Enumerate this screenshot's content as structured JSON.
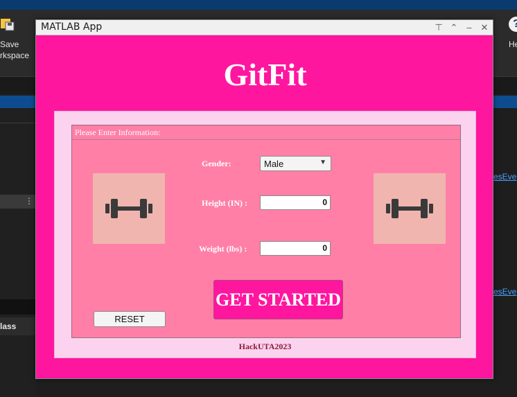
{
  "background": {
    "save_label_line1": "Save",
    "save_label_line2": "rkspace",
    "help_label": "He",
    "left_pane_class_label": "lass",
    "link_fragment": "esEve"
  },
  "window": {
    "title": "MATLAB App",
    "controls": {
      "pin": "⊤",
      "collapse": "⌃",
      "minimize": "–",
      "close": "✕"
    }
  },
  "app": {
    "title": "GitFit",
    "panel_title": "Please Enter Information:",
    "fields": {
      "gender_label": "Gender:",
      "gender_value": "Male",
      "height_label": "Height (IN) :",
      "height_value": "0",
      "weight_label": "Weight (lbs) :",
      "weight_value": "0"
    },
    "buttons": {
      "start": "GET STARTED",
      "reset": "RESET"
    },
    "footer": "HackUTA2023"
  },
  "colors": {
    "window_bg": "#ff169f",
    "outer_panel": "#fbd3ee",
    "inner_panel": "#ff7fa7",
    "image_box": "#f0b5ae",
    "dumbbell": "#3a3a3a",
    "footer_text": "#8b1a3c"
  },
  "icons": {
    "dumbbell": "dumbbell-icon",
    "dropdown_caret": "caret-down-icon"
  }
}
